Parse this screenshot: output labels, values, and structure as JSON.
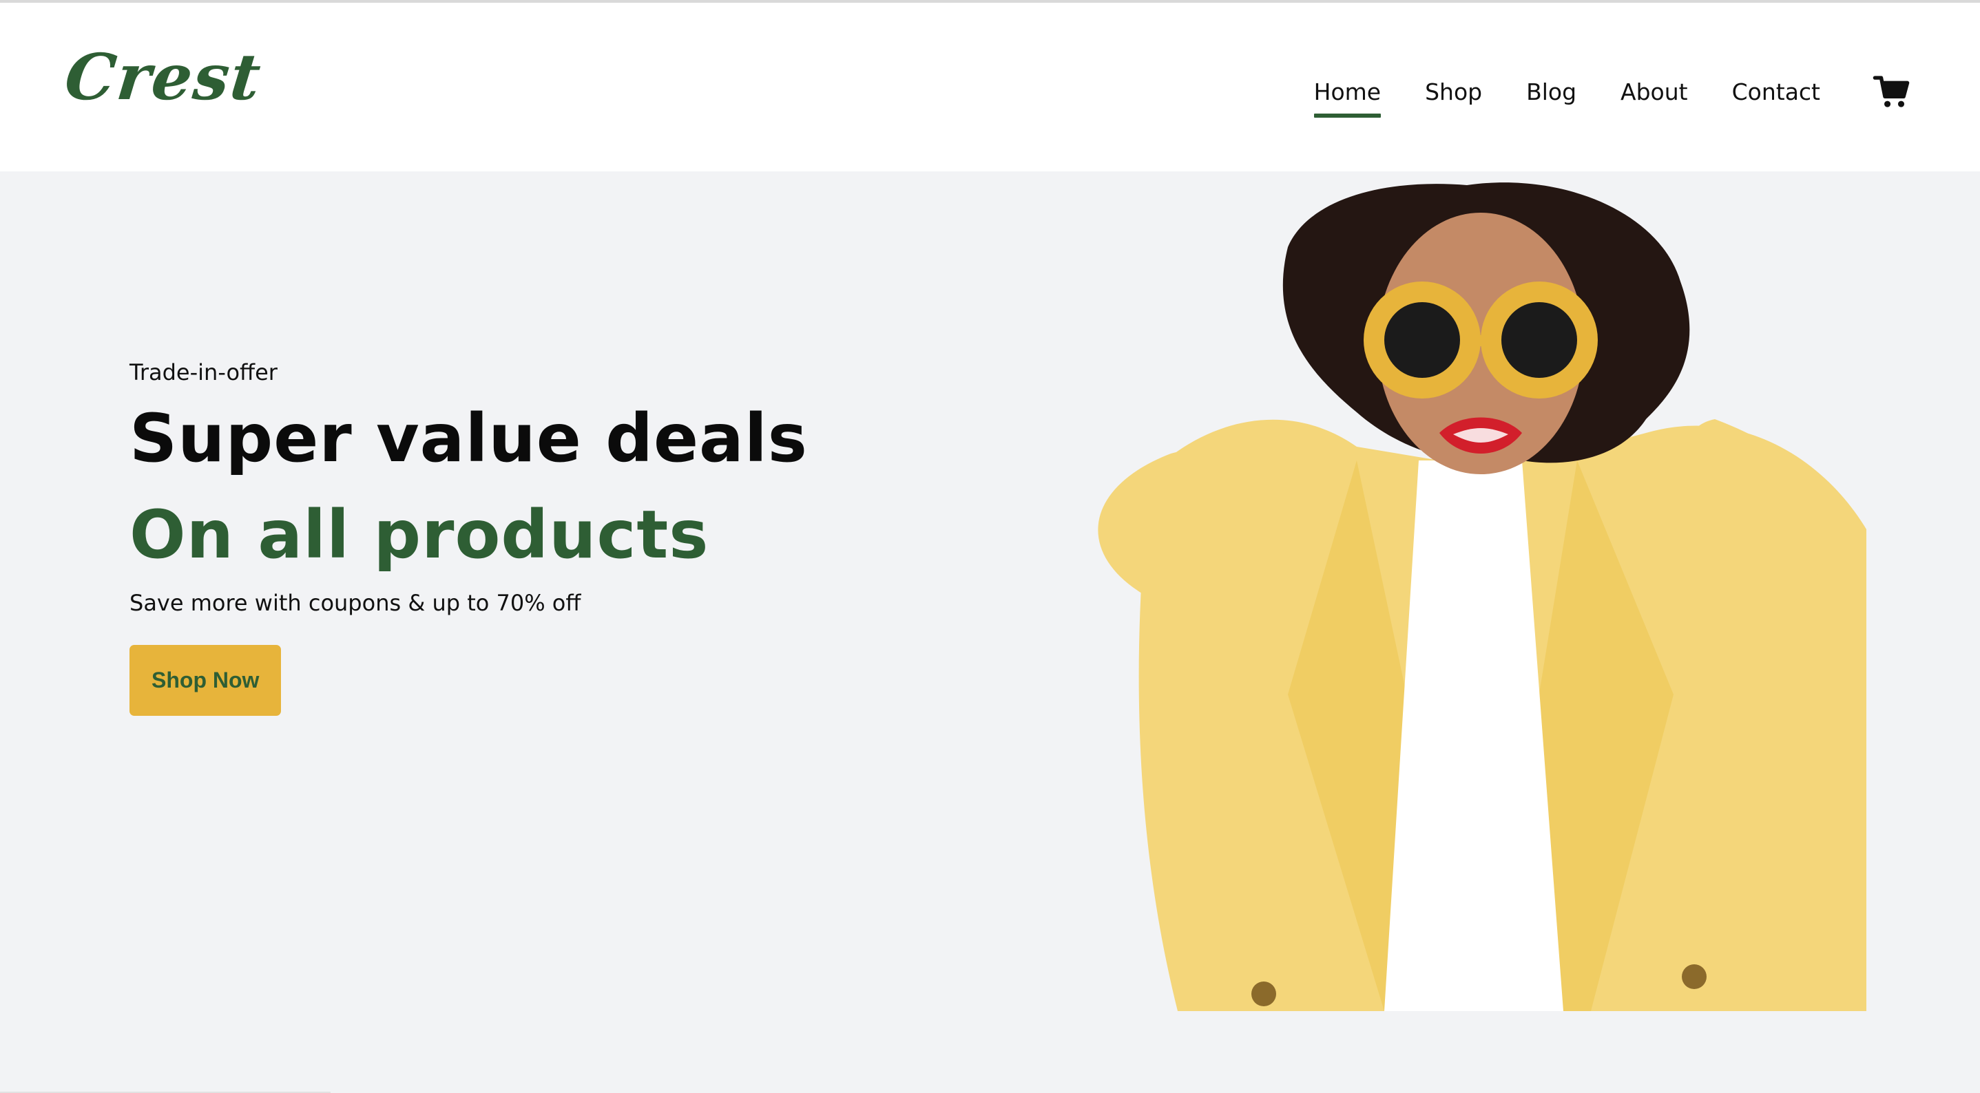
{
  "brand": {
    "logo_text": "Crest",
    "primary_color": "#2e5e34",
    "accent_color": "#e7b43b",
    "hero_background": "#f2f3f5"
  },
  "nav": {
    "items": [
      {
        "label": "Home",
        "active": true
      },
      {
        "label": "Shop",
        "active": false
      },
      {
        "label": "Blog",
        "active": false
      },
      {
        "label": "About",
        "active": false
      },
      {
        "label": "Contact",
        "active": false
      }
    ],
    "cart_icon": "shopping-cart-icon"
  },
  "hero": {
    "eyebrow": "Trade-in-offer",
    "headline": "Super value deals",
    "headline_accent": "On all products",
    "subtext": "Save more with coupons & up to 70% off",
    "cta_label": "Shop Now"
  }
}
